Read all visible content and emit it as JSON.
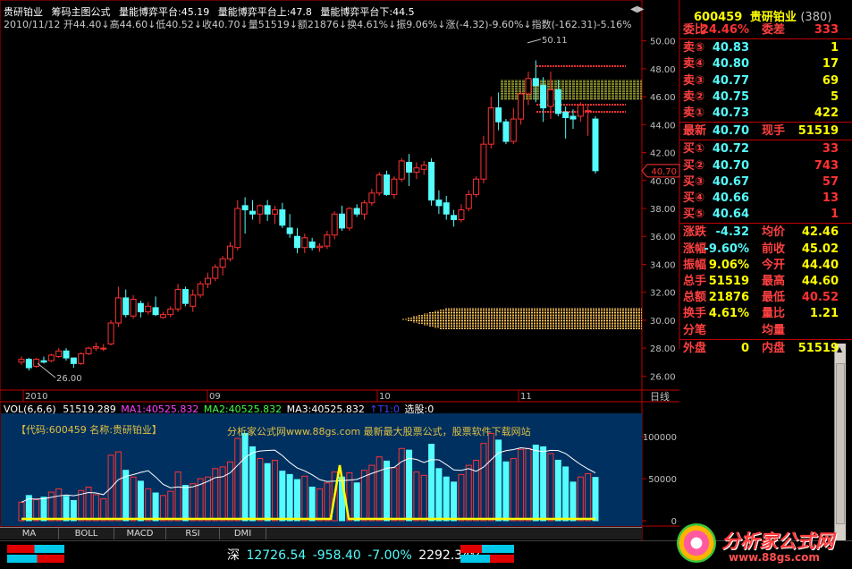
{
  "stock": {
    "name": "贵研铂业",
    "code": "600459",
    "code_label": "600459",
    "name_label": "贵研铂业",
    "count": "(380)"
  },
  "header": {
    "line1": [
      "贵研铂业",
      "筹码主图公式",
      "量能博弈平台:45.19",
      "量能博弈平台上:47.8",
      "量能博弈平台下:44.5"
    ],
    "line2": "2010/11/12 开44.40↓高44.60↓低40.52↓收40.70↓量51519↓额21876↓换4.61%↓振9.06%↓涨(-4.32)-9.60%↓指数(-162.31)-5.16%"
  },
  "price_axis": {
    "labels": [
      "50.00",
      "48.00",
      "46.00",
      "44.00",
      "42.00",
      "40.00",
      "38.00",
      "36.00",
      "34.00",
      "32.00",
      "30.00",
      "28.00",
      "26.00"
    ],
    "current": "40.70"
  },
  "annotations": {
    "high": "50.11",
    "low": "26.00"
  },
  "date_axis": {
    "labels": [
      "2010",
      "09",
      "10",
      "11"
    ],
    "corner": "日线"
  },
  "volume_header": {
    "vol": "VOL(6,6,6)",
    "vol_value": "51519.289",
    "ma1": "MA1:40525.832",
    "ma2": "MA2:40525.832",
    "ma3": "MA3:40525.832",
    "t1": "↑T1:0",
    "select": "选股:0"
  },
  "volume_axis": {
    "labels": [
      "100000",
      "50000",
      "0"
    ]
  },
  "watermark": {
    "code_line": "【代码:600459 名称:贵研铂业】",
    "site_line": "分析家公式网www.88gs.com 最新最大股票公式，股票软件下载网站"
  },
  "tabs": [
    "MA",
    "BOLL",
    "MACD",
    "RSI",
    "DMI"
  ],
  "quote": {
    "weibi": {
      "label": "委比",
      "value": "24.46%",
      "label2": "委差",
      "value2": "333"
    },
    "sells": [
      {
        "label": "卖⑤",
        "price": "40.83",
        "vol": "1"
      },
      {
        "label": "卖④",
        "price": "40.80",
        "vol": "17"
      },
      {
        "label": "卖③",
        "price": "40.77",
        "vol": "69"
      },
      {
        "label": "卖②",
        "price": "40.75",
        "vol": "5"
      },
      {
        "label": "卖①",
        "price": "40.73",
        "vol": "422"
      }
    ],
    "latest": {
      "label": "最新",
      "price": "40.70",
      "label2": "现手",
      "vol": "51519"
    },
    "buys": [
      {
        "label": "买①",
        "price": "40.72",
        "vol": "33"
      },
      {
        "label": "买②",
        "price": "40.70",
        "vol": "743"
      },
      {
        "label": "买③",
        "price": "40.67",
        "vol": "57"
      },
      {
        "label": "买④",
        "price": "40.66",
        "vol": "13"
      },
      {
        "label": "买⑤",
        "price": "40.64",
        "vol": "1"
      }
    ],
    "stats": [
      {
        "l1": "涨跌",
        "v1": "-4.32",
        "l2": "均价",
        "v2": "42.46"
      },
      {
        "l1": "涨幅",
        "v1": "-9.60%",
        "l2": "前收",
        "v2": "45.02"
      },
      {
        "l1": "振幅",
        "v1": "9.06%",
        "l2": "今开",
        "v2": "44.40"
      },
      {
        "l1": "总手",
        "v1": "51519",
        "l2": "最高",
        "v2": "44.60"
      },
      {
        "l1": "总额",
        "v1": "21876",
        "l2": "最低",
        "v2": "40.52"
      },
      {
        "l1": "换手",
        "v1": "4.61%",
        "l2": "量比",
        "v2": "1.21"
      },
      {
        "l1": "分笔",
        "v1": "",
        "l2": "均量",
        "v2": ""
      },
      {
        "l1": "外盘",
        "v1": "0",
        "l2": "内盘",
        "v2": "51519"
      }
    ]
  },
  "status": {
    "index_name": "深",
    "index_value": "12726.54",
    "change": "-958.40",
    "pct": "-7.00%",
    "amount": "2292.34亿"
  },
  "brand": {
    "name": "分析家公式网",
    "url": "www.88gs.com"
  },
  "colors": {
    "up": "#ff3232",
    "down": "#54fcfc",
    "ma_line": "#ffffff",
    "accent_yellow": "#ffff00",
    "panel_bg": "#003060"
  },
  "chart_data": {
    "type": "candlestick",
    "price_ylim": [
      25,
      51
    ],
    "volume_ylim": [
      0,
      130000
    ],
    "candles": [
      [
        27.0,
        27.4,
        26.8,
        27.2,
        22000
      ],
      [
        27.2,
        27.3,
        26.4,
        26.6,
        30000
      ],
      [
        26.7,
        27.3,
        26.6,
        27.2,
        25000
      ],
      [
        27.1,
        27.4,
        26.9,
        27.0,
        28000
      ],
      [
        27.1,
        27.6,
        27.0,
        27.5,
        34000
      ],
      [
        27.4,
        28.0,
        27.3,
        27.8,
        38000
      ],
      [
        27.8,
        28.0,
        27.1,
        27.3,
        29000
      ],
      [
        27.3,
        27.3,
        26.6,
        26.9,
        24000
      ],
      [
        26.9,
        27.7,
        26.8,
        27.6,
        36000
      ],
      [
        27.6,
        28.1,
        27.5,
        28.0,
        40000
      ],
      [
        28.0,
        28.4,
        27.8,
        28.1,
        31000
      ],
      [
        28.0,
        28.3,
        27.8,
        28.0,
        26000
      ],
      [
        28.3,
        30.0,
        28.2,
        29.8,
        78000
      ],
      [
        29.8,
        32.4,
        29.5,
        31.6,
        82000
      ],
      [
        31.6,
        32.2,
        30.2,
        30.4,
        60000
      ],
      [
        30.3,
        31.8,
        30.1,
        31.5,
        52000
      ],
      [
        31.2,
        31.4,
        30.2,
        30.6,
        47000
      ],
      [
        30.6,
        31.3,
        30.4,
        31.0,
        38000
      ],
      [
        30.9,
        31.7,
        30.3,
        30.4,
        33000
      ],
      [
        30.2,
        30.6,
        30.1,
        30.4,
        30000
      ],
      [
        30.4,
        31.0,
        30.2,
        30.8,
        35000
      ],
      [
        30.8,
        32.6,
        30.6,
        32.2,
        58000
      ],
      [
        32.2,
        32.4,
        31.0,
        31.2,
        42000
      ],
      [
        31.0,
        32.2,
        30.6,
        31.8,
        44000
      ],
      [
        31.8,
        32.8,
        31.6,
        32.6,
        50000
      ],
      [
        32.6,
        33.4,
        32.3,
        33.0,
        52000
      ],
      [
        33.0,
        34.0,
        32.8,
        33.8,
        62000
      ],
      [
        33.8,
        34.6,
        33.2,
        34.4,
        64000
      ],
      [
        34.4,
        35.6,
        34.2,
        35.3,
        70000
      ],
      [
        35.2,
        38.6,
        35.0,
        38.0,
        98000
      ],
      [
        38.2,
        38.8,
        36.2,
        37.9,
        104000
      ],
      [
        37.8,
        38.6,
        37.2,
        37.6,
        88000
      ],
      [
        37.6,
        38.3,
        36.9,
        38.2,
        74000
      ],
      [
        38.2,
        38.6,
        37.1,
        37.6,
        68000
      ],
      [
        37.6,
        38.2,
        36.9,
        37.9,
        72000
      ],
      [
        37.9,
        38.4,
        36.6,
        36.8,
        59000
      ],
      [
        36.6,
        37.6,
        35.9,
        36.2,
        55000
      ],
      [
        36.0,
        36.6,
        34.8,
        35.2,
        49000
      ],
      [
        35.2,
        36.2,
        34.8,
        35.9,
        53000
      ],
      [
        35.6,
        35.9,
        35.0,
        35.2,
        40000
      ],
      [
        35.2,
        35.5,
        34.9,
        35.3,
        38000
      ],
      [
        35.3,
        36.4,
        35.1,
        36.1,
        45000
      ],
      [
        36.1,
        37.8,
        35.8,
        37.6,
        58000
      ],
      [
        37.6,
        38.2,
        36.4,
        36.6,
        52000
      ],
      [
        36.6,
        38.1,
        36.4,
        38.0,
        57000
      ],
      [
        38.0,
        38.3,
        37.4,
        37.6,
        45000
      ],
      [
        37.6,
        38.6,
        37.2,
        38.4,
        60000
      ],
      [
        38.4,
        39.4,
        38.2,
        39.1,
        66000
      ],
      [
        39.1,
        40.6,
        38.9,
        40.4,
        76000
      ],
      [
        40.4,
        40.7,
        38.9,
        39.0,
        71000
      ],
      [
        39.0,
        40.3,
        38.7,
        40.1,
        63000
      ],
      [
        40.1,
        41.6,
        39.9,
        41.4,
        86000
      ],
      [
        41.3,
        41.9,
        39.6,
        40.6,
        84000
      ],
      [
        40.6,
        41.3,
        40.1,
        40.9,
        58000
      ],
      [
        40.8,
        41.4,
        40.4,
        41.1,
        54000
      ],
      [
        41.3,
        41.6,
        38.2,
        38.6,
        91000
      ],
      [
        38.6,
        39.3,
        37.6,
        38.2,
        62000
      ],
      [
        38.4,
        38.9,
        37.2,
        37.6,
        52000
      ],
      [
        37.5,
        37.9,
        36.7,
        37.2,
        46000
      ],
      [
        37.2,
        38.3,
        37.0,
        37.9,
        55000
      ],
      [
        38.0,
        39.3,
        37.8,
        39.0,
        66000
      ],
      [
        39.0,
        40.3,
        38.8,
        40.1,
        72000
      ],
      [
        40.1,
        43.2,
        39.8,
        42.6,
        92000
      ],
      [
        42.6,
        46.0,
        42.3,
        45.2,
        104000
      ],
      [
        45.2,
        46.3,
        43.6,
        44.2,
        96000
      ],
      [
        44.2,
        44.4,
        42.6,
        42.8,
        70000
      ],
      [
        42.8,
        45.2,
        42.6,
        44.4,
        74000
      ],
      [
        44.4,
        46.4,
        44.0,
        46.2,
        85000
      ],
      [
        46.2,
        47.8,
        45.4,
        47.3,
        86000
      ],
      [
        47.3,
        48.6,
        45.6,
        46.8,
        90000
      ],
      [
        46.8,
        47.4,
        44.2,
        45.2,
        88000
      ],
      [
        45.3,
        47.8,
        44.4,
        46.5,
        80000
      ],
      [
        46.5,
        47.2,
        44.6,
        44.8,
        72000
      ],
      [
        44.9,
        45.3,
        43.0,
        44.5,
        64000
      ],
      [
        44.6,
        45.1,
        43.7,
        44.4,
        46000
      ],
      [
        44.6,
        45.6,
        44.2,
        45.4,
        52000
      ],
      [
        45.0,
        45.4,
        43.2,
        45.0,
        56000
      ],
      [
        44.4,
        44.6,
        40.5,
        40.7,
        51519
      ]
    ]
  }
}
